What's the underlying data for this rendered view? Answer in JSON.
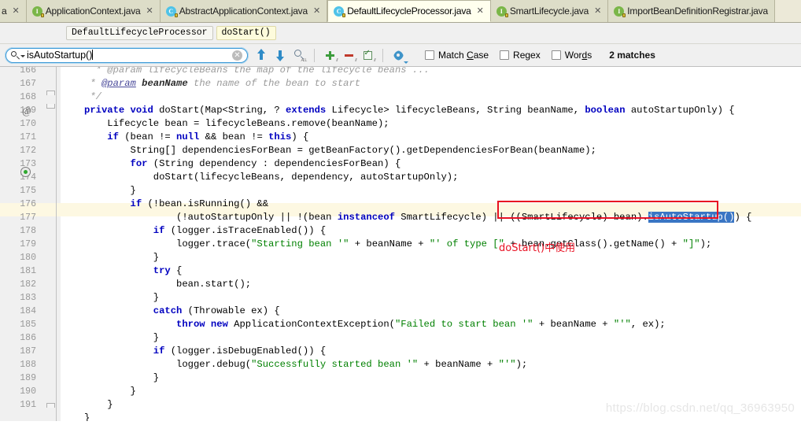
{
  "window": {
    "kind": "ide-editor",
    "watermark": "https://blog.csdn.net/qq_36963950"
  },
  "tabs": [
    {
      "label": "a",
      "icon": "java-interface-icon",
      "partial": true,
      "active": false
    },
    {
      "label": "ApplicationContext.java",
      "icon": "java-interface-icon",
      "active": false
    },
    {
      "label": "AbstractApplicationContext.java",
      "icon": "java-class-icon",
      "active": false
    },
    {
      "label": "DefaultLifecycleProcessor.java",
      "icon": "java-class-icon",
      "active": true
    },
    {
      "label": "SmartLifecycle.java",
      "icon": "java-interface-icon",
      "active": false
    },
    {
      "label": "ImportBeanDefinitionRegistrar.java",
      "icon": "java-interface-icon",
      "active": false
    }
  ],
  "tab_close_glyph": "✕",
  "breadcrumb": {
    "class": "DefaultLifecycleProcessor",
    "method": "doStart()"
  },
  "search": {
    "query": "isAutoStartup()",
    "placeholder": "",
    "clear_glyph": "✕",
    "matches_label": "2 matches",
    "toolbar": [
      {
        "name": "find-previous-button",
        "title": "Previous Occurrence"
      },
      {
        "name": "find-next-button",
        "title": "Next Occurrence"
      },
      {
        "name": "find-all-button",
        "title": "Find All"
      },
      {
        "name": "add-selection-button",
        "title": "Select Next Occurrence"
      },
      {
        "name": "remove-selection-button",
        "title": "Unselect Occurrence"
      },
      {
        "name": "select-all-occurrences-button",
        "title": "Select All Occurrences"
      },
      {
        "name": "find-settings-button",
        "title": "Find Settings"
      }
    ],
    "options": [
      {
        "label": "Match Case",
        "checked": false,
        "mnemonic": "C"
      },
      {
        "label": "Regex",
        "checked": false,
        "mnemonic": ""
      },
      {
        "label": "Words",
        "checked": false,
        "mnemonic": "d"
      }
    ]
  },
  "annotations": {
    "note_text": "doStart()中使用",
    "note_color": "#e81123",
    "box_color": "#e81123"
  },
  "editor": {
    "first_line": 166,
    "highlight_line": 177,
    "lines": [
      {
        "n": 166,
        "text": "",
        "clipped": true
      },
      {
        "n": 167,
        "text": " * @param beanName the name of the bean to start"
      },
      {
        "n": 168,
        "text": " */"
      },
      {
        "n": 169,
        "text": "private void doStart(Map<String, ? extends Lifecycle> lifecycleBeans, String beanName, boolean autoStartupOnly) {"
      },
      {
        "n": 170,
        "text": "    Lifecycle bean = lifecycleBeans.remove(beanName);"
      },
      {
        "n": 171,
        "text": "    if (bean != null && bean != this) {"
      },
      {
        "n": 172,
        "text": "        String[] dependenciesForBean = getBeanFactory().getDependenciesForBean(beanName);"
      },
      {
        "n": 173,
        "text": "        for (String dependency : dependenciesForBean) {"
      },
      {
        "n": 174,
        "text": "            doStart(lifecycleBeans, dependency, autoStartupOnly);"
      },
      {
        "n": 175,
        "text": "        }"
      },
      {
        "n": 176,
        "text": "        if (!bean.isRunning() &&"
      },
      {
        "n": 177,
        "text": "                (!autoStartupOnly || !(bean instanceof SmartLifecycle) || ((SmartLifecycle) bean).isAutoStartup())) {"
      },
      {
        "n": 178,
        "text": "            if (logger.isTraceEnabled()) {"
      },
      {
        "n": 179,
        "text": "                logger.trace(\"Starting bean '\" + beanName + \"' of type [\" + bean.getClass().getName() + \"]\");"
      },
      {
        "n": 180,
        "text": "            }"
      },
      {
        "n": 181,
        "text": "            try {"
      },
      {
        "n": 182,
        "text": "                bean.start();"
      },
      {
        "n": 183,
        "text": "            }"
      },
      {
        "n": 184,
        "text": "            catch (Throwable ex) {"
      },
      {
        "n": 185,
        "text": "                throw new ApplicationContextException(\"Failed to start bean '\" + beanName + \"'\", ex);"
      },
      {
        "n": 186,
        "text": "            }"
      },
      {
        "n": 187,
        "text": "            if (logger.isDebugEnabled()) {"
      },
      {
        "n": 188,
        "text": "                logger.debug(\"Successfully started bean '\" + beanName + \"'\");"
      },
      {
        "n": 189,
        "text": "            }"
      },
      {
        "n": 190,
        "text": "        }"
      },
      {
        "n": 191,
        "text": "    }"
      },
      {
        "n": 192,
        "text": "}"
      }
    ],
    "selected_text": "isAutoStartup()",
    "gutter_marks": [
      {
        "line": 169,
        "name": "override-marker",
        "glyph": "@"
      },
      {
        "line": 174,
        "name": "recursive-call-marker",
        "glyph": "↺"
      }
    ]
  }
}
